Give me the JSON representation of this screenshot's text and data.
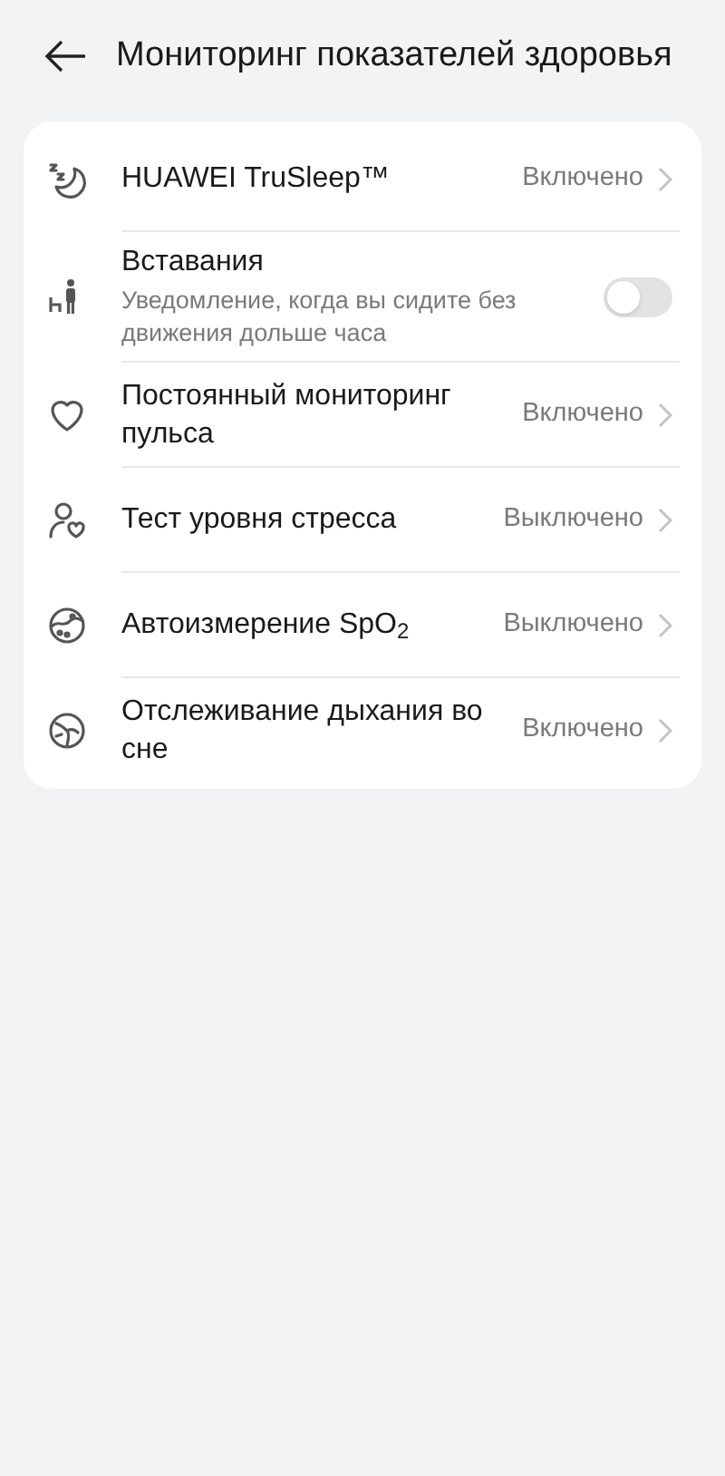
{
  "header": {
    "title": "Мониторинг показателей здоровья"
  },
  "items": [
    {
      "kind": "link",
      "title": "HUAWEI TruSleep™",
      "value": "Включено"
    },
    {
      "kind": "toggle",
      "title": "Вставания",
      "subtitle": "Уведомление, когда вы сидите без движения дольше часа",
      "on": false
    },
    {
      "kind": "link",
      "title": "Постоянный мониторинг пульса",
      "value": "Включено"
    },
    {
      "kind": "link",
      "title": "Тест уровня стресса",
      "value": "Выключено"
    },
    {
      "kind": "link",
      "title": "Автоизмерение SpO$_{2}$",
      "value": "Выключено"
    },
    {
      "kind": "link",
      "title": "Отслеживание дыхания во сне",
      "value": "Включено"
    }
  ]
}
